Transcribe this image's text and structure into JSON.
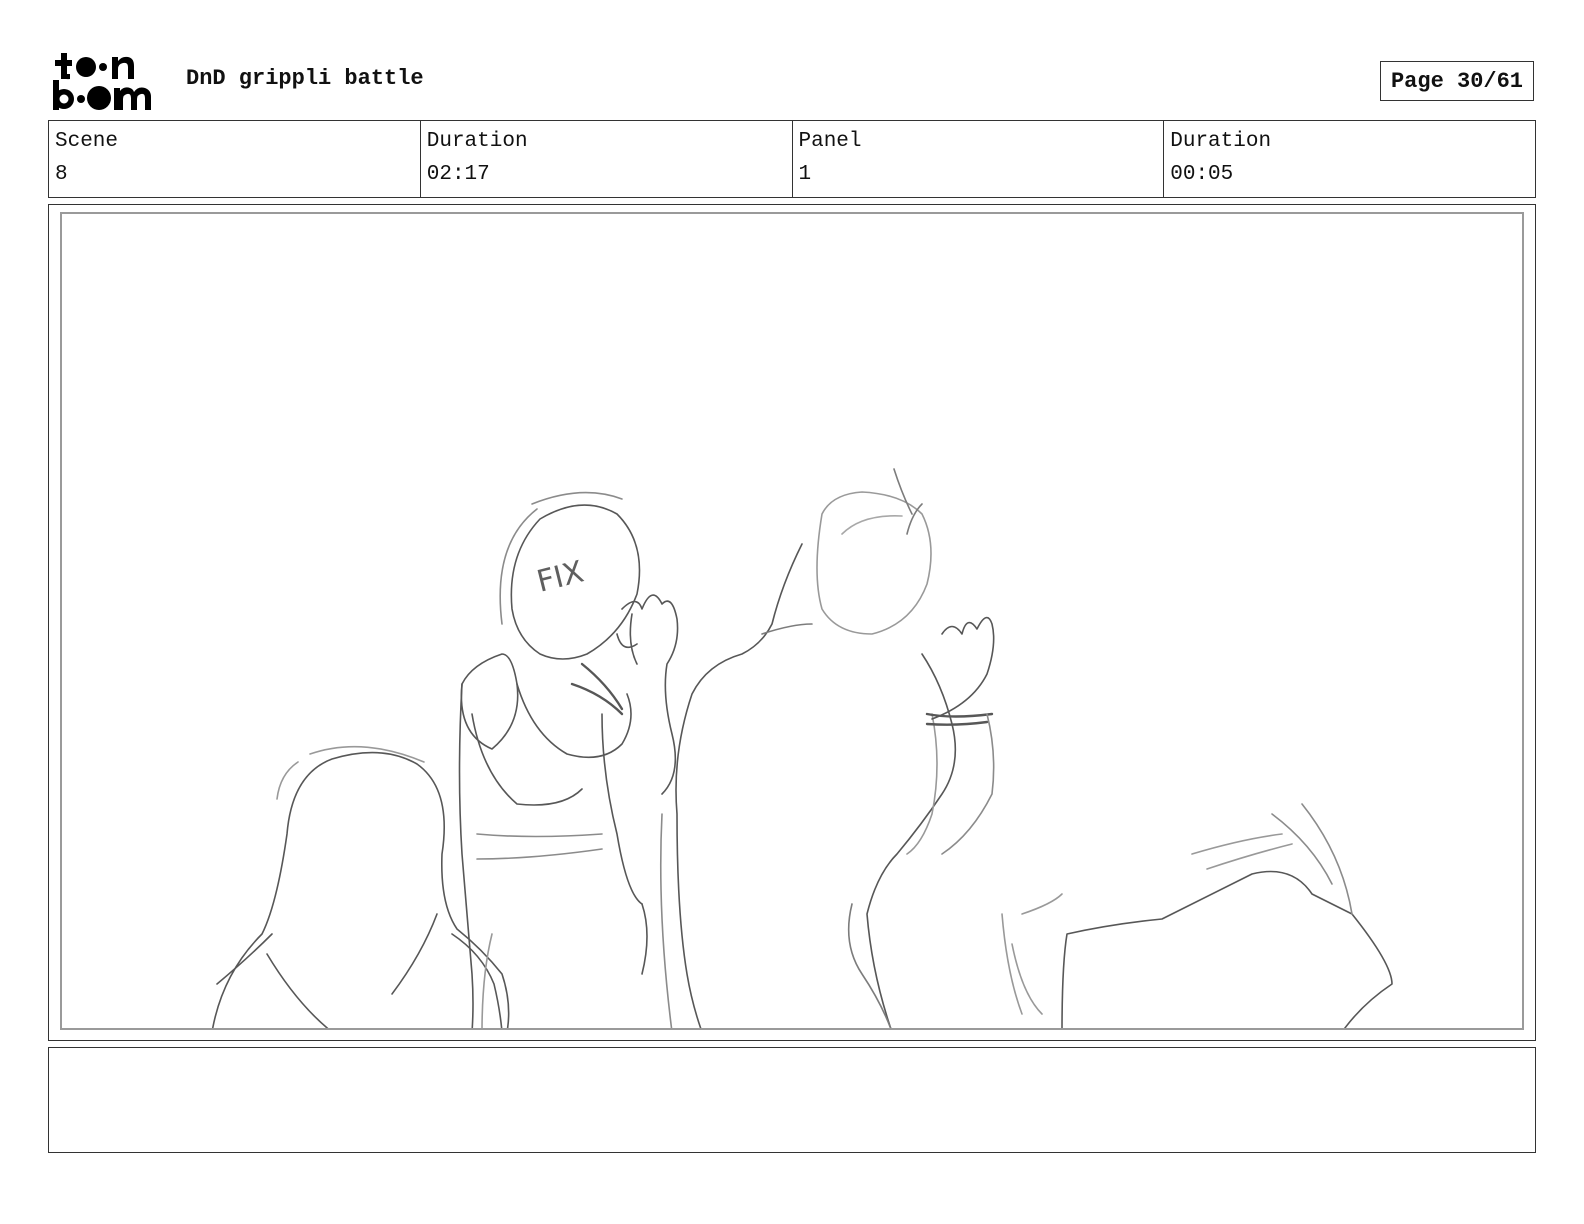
{
  "header": {
    "logo_text": "toon boom",
    "project_title": "DnD grippli battle",
    "page_indicator": "Page 30/61"
  },
  "info": {
    "scene_label": "Scene",
    "scene_value": "8",
    "scene_duration_label": "Duration",
    "scene_duration_value": "02:17",
    "panel_label": "Panel",
    "panel_value": "1",
    "panel_duration_label": "Duration",
    "panel_duration_value": "00:05"
  },
  "panel": {
    "sketch_annotation": "FIX"
  },
  "notes": {
    "text": ""
  }
}
